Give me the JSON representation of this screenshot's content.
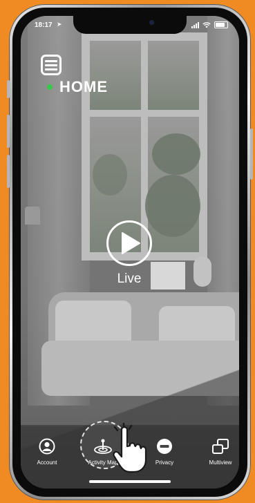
{
  "status": {
    "time": "18:17"
  },
  "header": {
    "title": "HOME",
    "status_color": "#35c84a"
  },
  "player": {
    "live_label": "Live"
  },
  "tabs": [
    {
      "label": "Account",
      "icon": "account-icon"
    },
    {
      "label": "Activity Map",
      "icon": "activity-map-icon"
    },
    {
      "label": "Privacy",
      "icon": "privacy-icon"
    },
    {
      "label": "Multiview",
      "icon": "multiview-icon"
    }
  ],
  "colors": {
    "background": "#f08a22",
    "accent": "#35c84a"
  }
}
